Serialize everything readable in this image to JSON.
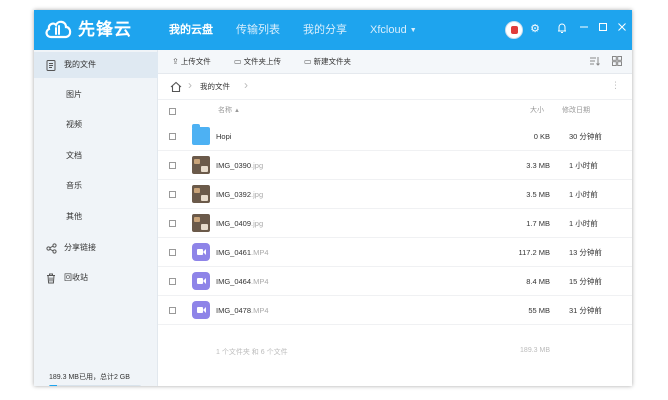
{
  "app": {
    "brand": "先锋云",
    "accent_color": "#1ea4ee"
  },
  "nav": {
    "items": [
      {
        "label": "我的云盘",
        "active": true
      },
      {
        "label": "传输列表",
        "active": false
      },
      {
        "label": "我的分享",
        "active": false
      },
      {
        "label": "Xfcloud",
        "active": false,
        "dropdown": true
      }
    ]
  },
  "titlebar_icons": [
    "avatar",
    "gear-icon",
    "bell-icon",
    "minimize-icon",
    "maximize-icon",
    "close-icon"
  ],
  "sidebar": {
    "items": [
      {
        "label": "我的文件",
        "icon": "file-list-icon",
        "active": true
      },
      {
        "label": "图片",
        "sub": true
      },
      {
        "label": "视频",
        "sub": true
      },
      {
        "label": "文档",
        "sub": true
      },
      {
        "label": "音乐",
        "sub": true
      },
      {
        "label": "其他",
        "sub": true
      },
      {
        "label": "分享链接",
        "icon": "share-icon"
      },
      {
        "label": "回收站",
        "icon": "trash-icon"
      }
    ],
    "quota_text": "189.3 MB已用，总计2 GB",
    "quota_fraction": 0.09
  },
  "toolbar": {
    "upload_file": "上传文件",
    "upload_folder": "文件夹上传",
    "new_folder": "新建文件夹"
  },
  "breadcrumb": {
    "current": "我的文件"
  },
  "table": {
    "headers": {
      "name": "名称",
      "size": "大小",
      "modified": "修改日期"
    },
    "rows": [
      {
        "type": "folder",
        "name": "Hopi",
        "ext": "",
        "size": "0 KB",
        "modified": "30 分钟前"
      },
      {
        "type": "image",
        "name": "IMG_0390",
        "ext": ".jpg",
        "size": "3.3 MB",
        "modified": "1 小时前"
      },
      {
        "type": "image",
        "name": "IMG_0392",
        "ext": ".jpg",
        "size": "3.5 MB",
        "modified": "1 小时前"
      },
      {
        "type": "image",
        "name": "IMG_0409",
        "ext": ".jpg",
        "size": "1.7 MB",
        "modified": "1 小时前"
      },
      {
        "type": "video",
        "name": "IMG_0461",
        "ext": ".MP4",
        "size": "117.2 MB",
        "modified": "13 分钟前"
      },
      {
        "type": "video",
        "name": "IMG_0464",
        "ext": ".MP4",
        "size": "8.4 MB",
        "modified": "15 分钟前"
      },
      {
        "type": "video",
        "name": "IMG_0478",
        "ext": ".MP4",
        "size": "55 MB",
        "modified": "31 分钟前"
      }
    ],
    "summary": "1 个文件夹 和 6 个文件",
    "summary_size": "189.3 MB"
  }
}
